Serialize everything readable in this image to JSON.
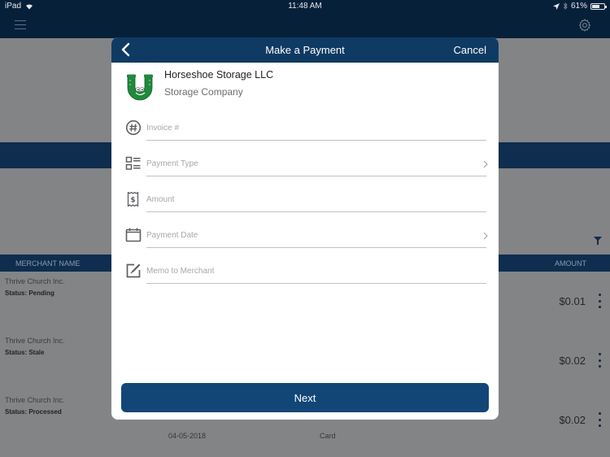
{
  "status_bar": {
    "device": "iPad",
    "time": "11:48 AM",
    "battery": "61%"
  },
  "background": {
    "columns": {
      "merchant": "MERCHANT NAME",
      "amount": "AMOUNT"
    },
    "rows": [
      {
        "merchant": "Thrive Church Inc.",
        "status": "Status: Pending",
        "amount": "$0.01",
        "date": "",
        "method": ""
      },
      {
        "merchant": "Thrive Church Inc.",
        "status": "Status: Stale",
        "amount": "$0.02",
        "date": "",
        "method": ""
      },
      {
        "merchant": "Thrive Church Inc.",
        "status": "Status: Processed",
        "amount": "$0.02",
        "date": "04-05-2018",
        "method": "Card"
      }
    ]
  },
  "modal": {
    "title": "Make a Payment",
    "cancel_label": "Cancel",
    "merchant": {
      "name": "Horseshoe Storage LLC",
      "type": "Storage Company"
    },
    "fields": [
      {
        "icon": "hash-icon",
        "placeholder": "Invoice #",
        "value": ""
      },
      {
        "icon": "list-icon",
        "placeholder": "Payment Type",
        "value": ""
      },
      {
        "icon": "receipt-dollar-icon",
        "placeholder": "Amount",
        "value": ""
      },
      {
        "icon": "calendar-icon",
        "placeholder": "Payment Date",
        "value": ""
      },
      {
        "icon": "edit-note-icon",
        "placeholder": "Memo to Merchant",
        "value": ""
      }
    ],
    "next_label": "Next"
  },
  "colors": {
    "nav_dark": "#06203a",
    "modal_header": "#0f3a63",
    "primary_button": "#124677",
    "logo_green": "#1f8a3c"
  }
}
